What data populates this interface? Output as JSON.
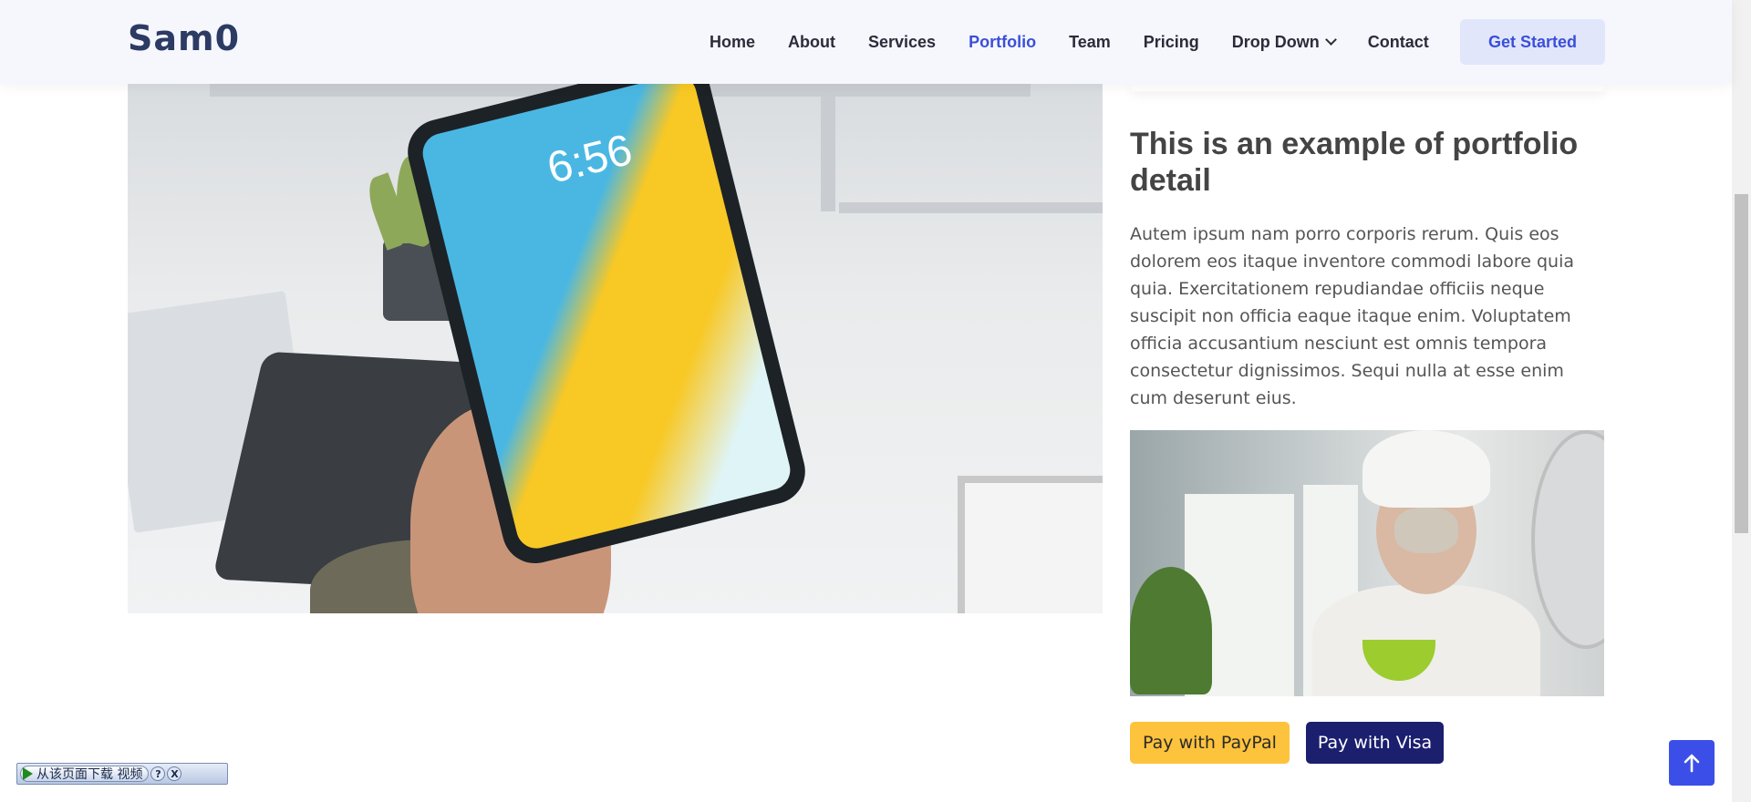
{
  "header": {
    "logo": "Sam0",
    "nav": [
      {
        "label": "Home",
        "active": false
      },
      {
        "label": "About",
        "active": false
      },
      {
        "label": "Services",
        "active": false
      },
      {
        "label": "Portfolio",
        "active": true
      },
      {
        "label": "Team",
        "active": false
      },
      {
        "label": "Pricing",
        "active": false
      },
      {
        "label": "Drop Down",
        "active": false
      },
      {
        "label": "Contact",
        "active": false
      }
    ],
    "cta": "Get Started"
  },
  "portfolio": {
    "tablet_time": "6:56",
    "title": "This is an example of portfolio detail",
    "description": "Autem ipsum nam porro corporis rerum. Quis eos dolorem eos itaque inventore commodi labore quia quia. Exercitationem repudiandae officiis neque suscipit non officia eaque itaque enim. Voluptatem officia accusantium nesciunt est omnis tempora consectetur dignissimos. Sequi nulla at esse enim cum deserunt eius."
  },
  "payments": {
    "paypal": "Pay with PayPal",
    "visa": "Pay with Visa"
  },
  "download_widget": {
    "label": "从该页面下载 视频",
    "help": "?",
    "close": "X"
  },
  "colors": {
    "accent": "#3b4fd8",
    "paypal": "#fec33c",
    "visa": "#1b1f6e",
    "header_bg": "#f5f7fd",
    "back_to_top": "#3b4fe8"
  },
  "icons": {
    "back_to_top": "arrow-up-icon",
    "dropdown": "chevron-down-icon",
    "download_play": "play-icon"
  }
}
